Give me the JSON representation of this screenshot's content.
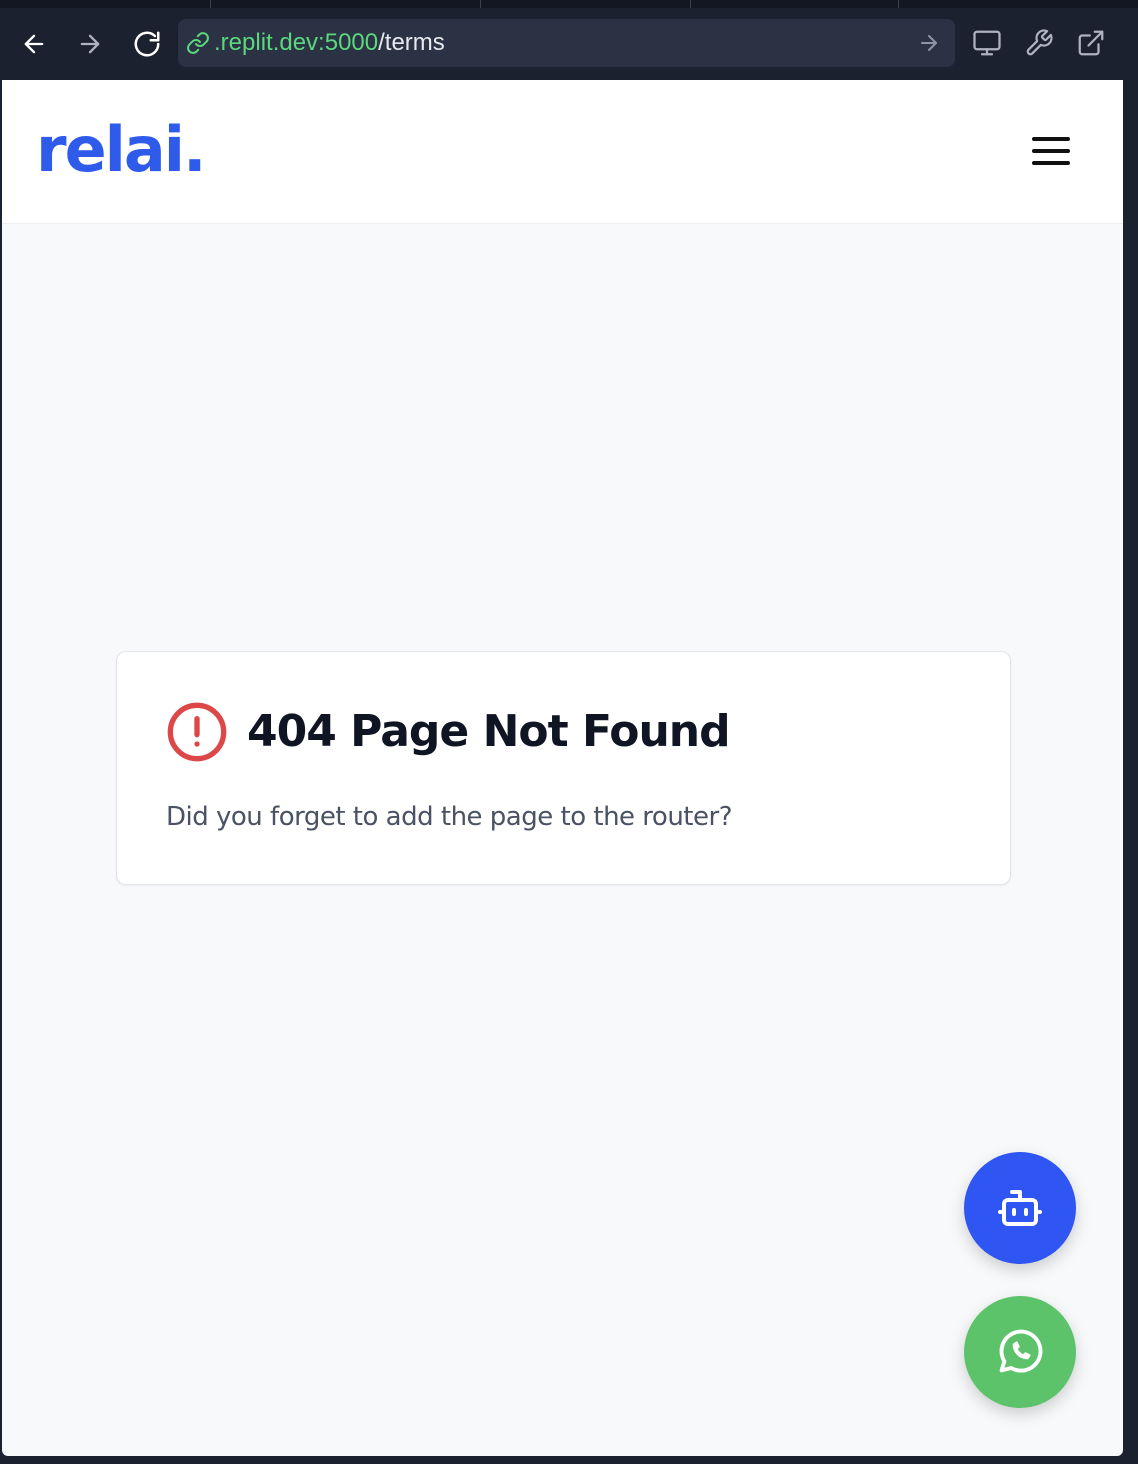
{
  "browser": {
    "url_host": ".replit.dev:5000",
    "url_path": "/terms"
  },
  "site": {
    "logo_text": "relai."
  },
  "error_card": {
    "title": "404 Page Not Found",
    "message": "Did you forget to add the page to the router?"
  },
  "colors": {
    "brand": "#2e5bea",
    "error_icon": "#dc4848",
    "bot_button": "#2f55f2",
    "whatsapp_button": "#5cc36a",
    "url_host": "#5bd77d"
  },
  "icons": {
    "back": "arrow-left-icon",
    "forward": "arrow-right-icon",
    "reload": "reload-icon",
    "url_link": "link-icon",
    "url_go": "arrow-right-icon",
    "devices": "monitor-icon",
    "devtools": "wrench-icon",
    "open_external": "external-link-icon",
    "menu": "hamburger-menu-icon",
    "error": "alert-circle-icon",
    "bot": "bot-icon",
    "whatsapp": "whatsapp-icon"
  }
}
